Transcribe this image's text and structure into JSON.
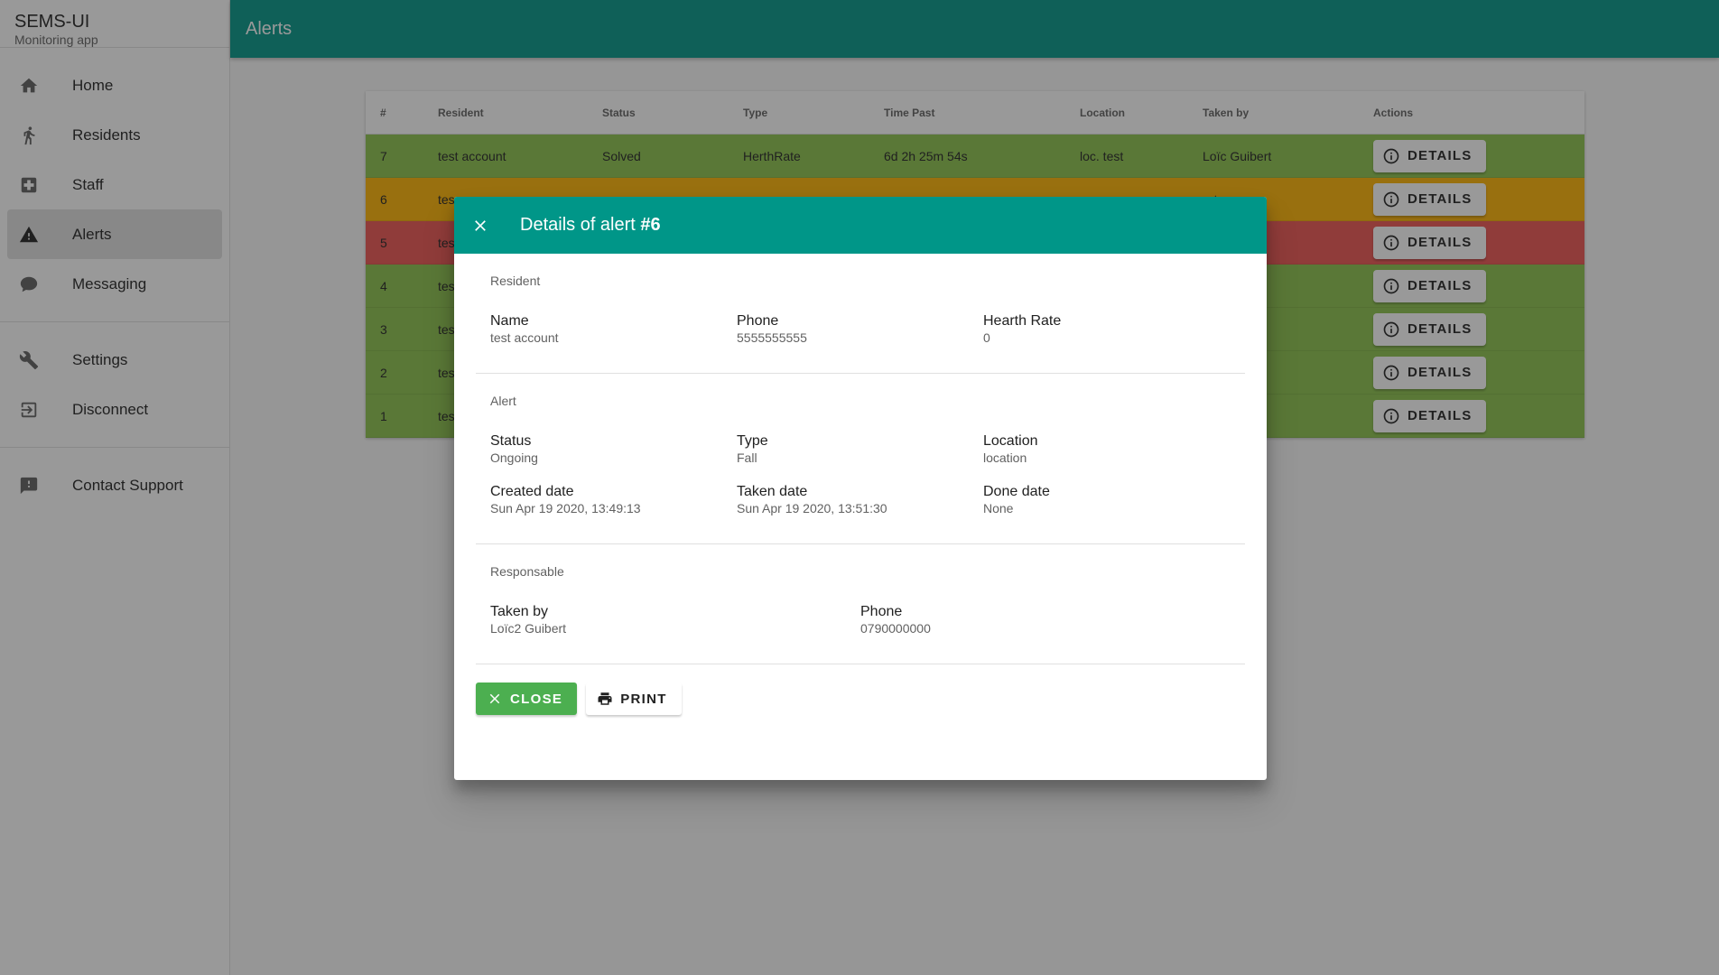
{
  "brand": {
    "title": "SEMS-UI",
    "subtitle": "Monitoring app"
  },
  "nav": {
    "home": "Home",
    "residents": "Residents",
    "staff": "Staff",
    "alerts": "Alerts",
    "messaging": "Messaging",
    "settings": "Settings",
    "disconnect": "Disconnect",
    "support": "Contact Support"
  },
  "appbar": {
    "title": "Alerts"
  },
  "table": {
    "headers": [
      "#",
      "Resident",
      "Status",
      "Type",
      "Time Past",
      "Location",
      "Taken by",
      "Actions"
    ],
    "action_label": "DETAILS",
    "rows": [
      {
        "id": "7",
        "resident": "test account",
        "status": "Solved",
        "type": "HerthRate",
        "time_past": "6d 2h 25m 54s",
        "location": "loc. test",
        "taken_by": "Loïc Guibert",
        "color": "#8bc34a"
      },
      {
        "id": "6",
        "resident": "tes",
        "status": "",
        "type": "",
        "time_past": "",
        "location": "",
        "taken_by": "ert",
        "color": "#ffb300"
      },
      {
        "id": "5",
        "resident": "tes",
        "status": "",
        "type": "",
        "time_past": "",
        "location": "",
        "taken_by": "",
        "color": "#ef5350"
      },
      {
        "id": "4",
        "resident": "tes",
        "status": "",
        "type": "",
        "time_past": "",
        "location": "",
        "taken_by": "rt",
        "color": "#8bc34a"
      },
      {
        "id": "3",
        "resident": "tes",
        "status": "",
        "type": "",
        "time_past": "",
        "location": "",
        "taken_by": "rt",
        "color": "#8bc34a"
      },
      {
        "id": "2",
        "resident": "tes",
        "status": "",
        "type": "",
        "time_past": "",
        "location": "",
        "taken_by": "rt",
        "color": "#8bc34a"
      },
      {
        "id": "1",
        "resident": "tes",
        "status": "",
        "type": "",
        "time_past": "",
        "location": "",
        "taken_by": "rt",
        "color": "#8bc34a"
      }
    ]
  },
  "dialog": {
    "title_prefix": "Details of alert ",
    "title_id": "#6",
    "resident": {
      "section_title": "Resident",
      "name_label": "Name",
      "name_value": "test account",
      "phone_label": "Phone",
      "phone_value": "5555555555",
      "rate_label": "Hearth Rate",
      "rate_value": "0"
    },
    "alert": {
      "section_title": "Alert",
      "status_label": "Status",
      "status_value": "Ongoing",
      "type_label": "Type",
      "type_value": "Fall",
      "location_label": "Location",
      "location_value": "location",
      "created_label": "Created date",
      "created_value": "Sun Apr 19 2020, 13:49:13",
      "taken_label": "Taken date",
      "taken_value": "Sun Apr 19 2020, 13:51:30",
      "done_label": "Done date",
      "done_value": "None"
    },
    "responsable": {
      "section_title": "Responsable",
      "taken_by_label": "Taken by",
      "taken_by_value": "Loïc2 Guibert",
      "phone_label": "Phone",
      "phone_value": "0790000000"
    },
    "close_label": "CLOSE",
    "print_label": "PRINT"
  },
  "colors": {
    "primary": "#009688",
    "solved": "#8bc34a",
    "ongoing": "#ffb300",
    "open": "#ef5350",
    "close_button": "#4caf50"
  }
}
